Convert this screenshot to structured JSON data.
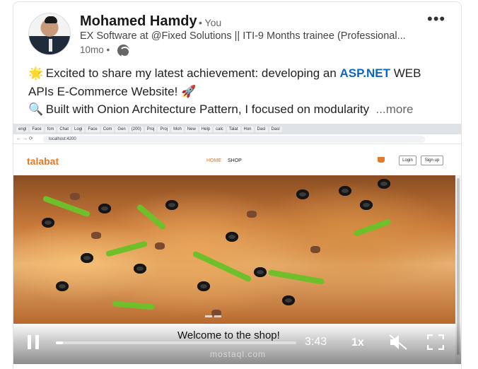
{
  "author": {
    "name": "Mohamed Hamdy",
    "you_label": "• You",
    "headline": "EX Software at @Fixed Solutions || ITI-9 Months trainee (Professional...",
    "time": "10mo •",
    "menu": "•••"
  },
  "post": {
    "line1_pre": "Excited to share my latest achievement: developing an ",
    "line1_link": "ASP.NET",
    "line1_post": " WEB",
    "line2": "APIs E-Commerce Website!",
    "line3": "Built with Onion Architecture Pattern, I focused on modularity",
    "see_more": "...more",
    "emoji_star": "🌟",
    "emoji_rocket": "🚀",
    "emoji_search": "🔍"
  },
  "browser": {
    "tabs": [
      "engl",
      "Face",
      "fcm",
      "Chat",
      "Logi",
      "Face",
      "Com",
      "Gen",
      "(200)",
      "Proj",
      "Proj",
      "Moh",
      "New",
      "Help",
      "calc",
      "Talat",
      "Hon",
      "Dasl",
      "Dasl"
    ],
    "url": "localhost:4200"
  },
  "site": {
    "brand": "talabat",
    "nav_home": "HOME",
    "nav_shop": "SHOP",
    "login": "Login",
    "signup": "Sign up"
  },
  "video": {
    "caption": "Welcome to the shop!",
    "duration": "3:43",
    "speed": "1x",
    "watermark": "mostaql.com",
    "progress": 0.03
  }
}
